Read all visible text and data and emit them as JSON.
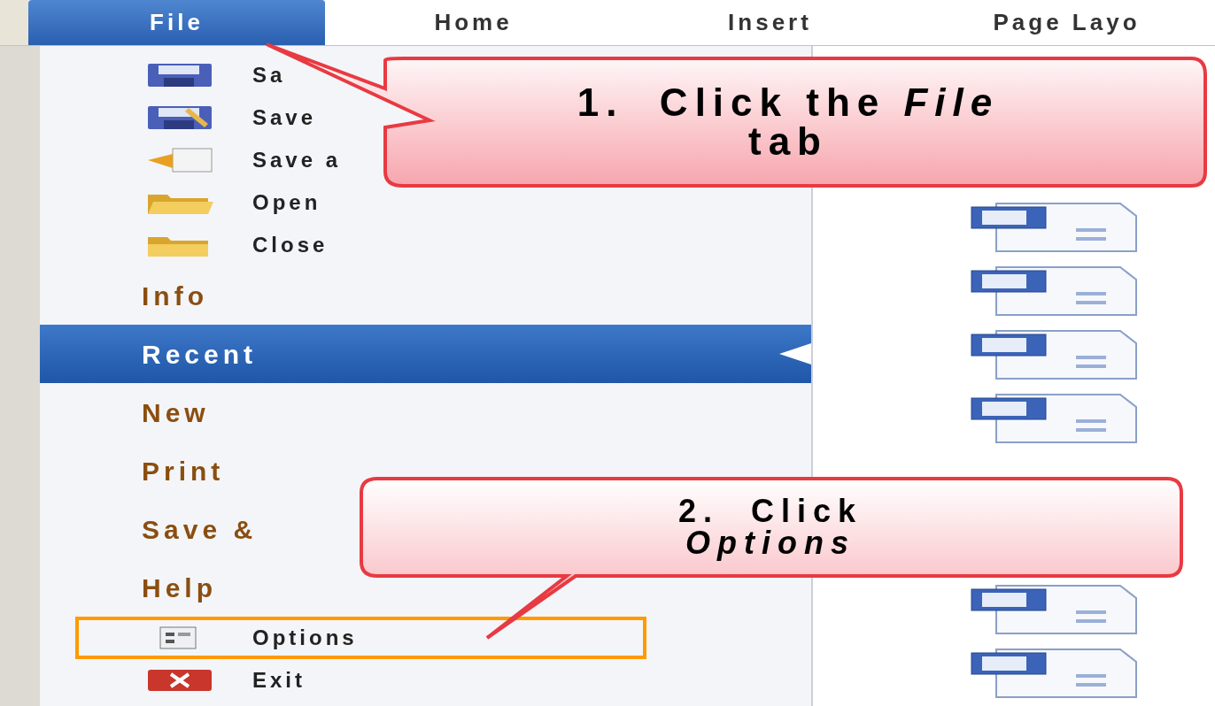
{
  "tabs": [
    {
      "label": "File",
      "selected": true
    },
    {
      "label": "Home",
      "selected": false
    },
    {
      "label": "Insert",
      "selected": false
    },
    {
      "label": "Page Layo",
      "selected": false
    }
  ],
  "menu": {
    "items": [
      {
        "kind": "command",
        "label": "Sa",
        "selected": false,
        "outlined": false
      },
      {
        "kind": "command",
        "label": "Save",
        "selected": false,
        "outlined": false
      },
      {
        "kind": "command",
        "label": "Save a",
        "selected": false,
        "outlined": false
      },
      {
        "kind": "command",
        "label": "Open",
        "selected": false,
        "outlined": false
      },
      {
        "kind": "command",
        "label": "Close",
        "selected": false,
        "outlined": false
      },
      {
        "kind": "section",
        "label": "Info",
        "selected": false,
        "outlined": false
      },
      {
        "kind": "section",
        "label": "Recent",
        "selected": true,
        "outlined": false
      },
      {
        "kind": "section",
        "label": "New",
        "selected": false,
        "outlined": false
      },
      {
        "kind": "section",
        "label": "Print",
        "selected": false,
        "outlined": false
      },
      {
        "kind": "section",
        "label": "Save &",
        "selected": false,
        "outlined": false
      },
      {
        "kind": "section",
        "label": "Help",
        "selected": false,
        "outlined": false
      },
      {
        "kind": "command",
        "label": "Options",
        "selected": false,
        "outlined": true
      },
      {
        "kind": "command",
        "label": "Exit",
        "selected": false,
        "outlined": false
      }
    ]
  },
  "callouts": [
    {
      "lines": [
        "1.  Click the *File*",
        "tab"
      ]
    },
    {
      "lines": [
        "2.  Click",
        "*Options*"
      ]
    }
  ]
}
